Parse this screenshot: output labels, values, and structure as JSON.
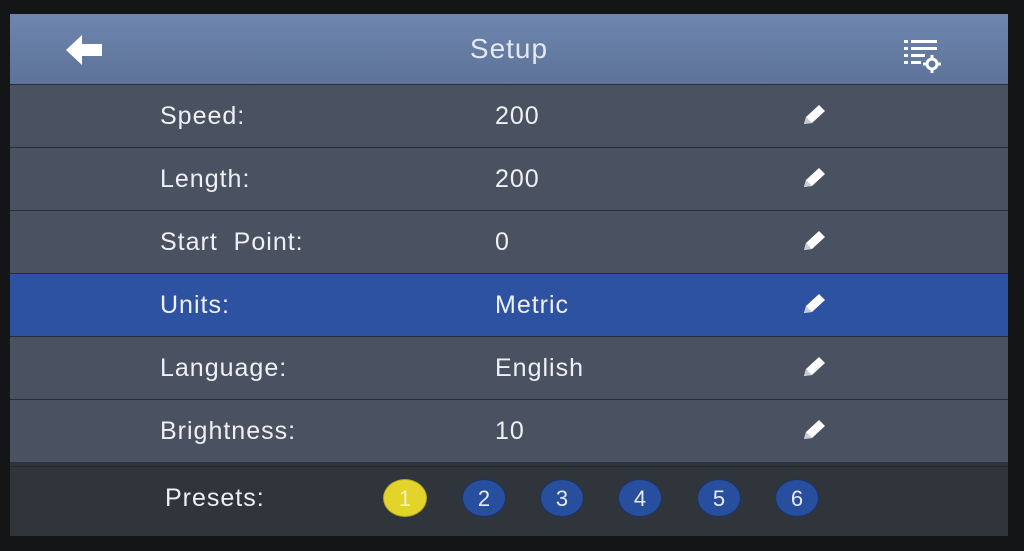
{
  "header": {
    "title": "Setup",
    "back_icon": "arrow-left-icon",
    "menu_icon": "settings-list-icon"
  },
  "rows": [
    {
      "label": "Speed:",
      "value": "200"
    },
    {
      "label": "Length:",
      "value": "200"
    },
    {
      "label": "Start  Point:",
      "value": "0"
    },
    {
      "label": "Units:",
      "value": "Metric",
      "selected": true
    },
    {
      "label": "Language:",
      "value": "English"
    },
    {
      "label": "Brightness:",
      "value": "10"
    }
  ],
  "presets": {
    "label": "Presets:",
    "items": [
      "1",
      "2",
      "3",
      "4",
      "5",
      "6"
    ],
    "active": "1"
  },
  "colors": {
    "header": "#6e85ad",
    "row": "#4a5261",
    "selected_row": "#2d52a2",
    "preset": "#274f9e",
    "preset_active": "#e2d42a"
  },
  "row_icon": "pencil-icon"
}
